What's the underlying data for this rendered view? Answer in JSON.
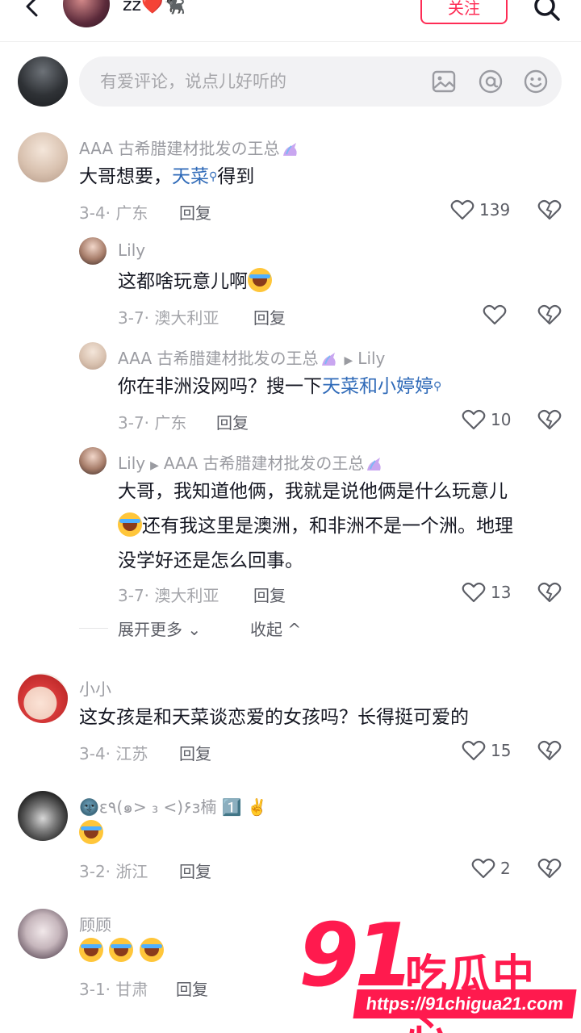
{
  "header": {
    "title": "zz❤️🐈‍⬛",
    "follow_label": "关注"
  },
  "composer": {
    "placeholder": "有爱评论，说点儿好听的"
  },
  "comments": [
    {
      "user": "AAA 古希腊建材批发の王总",
      "text_before": "大哥想要，",
      "link": "天菜",
      "text_after": "得到",
      "meta": "3-4· 广东",
      "reply": "回复",
      "likes": "139"
    },
    {
      "user": "Lily",
      "text": "这都啥玩意儿啊",
      "meta": "3-7· 澳大利亚",
      "reply": "回复",
      "likes": ""
    },
    {
      "user": "AAA 古希腊建材批发の王总",
      "reply_to": "Lily",
      "text_before": "你在非洲没网吗？搜一下",
      "link": "天菜和小婷婷",
      "meta": "3-7· 广东",
      "reply": "回复",
      "likes": "10"
    },
    {
      "user": "Lily",
      "reply_to": "AAA 古希腊建材批发の王总",
      "line1": "大哥，我知道他俩，我就是说他俩是什么玩意儿",
      "line2": "还有我这里是澳洲，和非洲不是一个洲。地理",
      "line3": "没学好还是怎么回事。",
      "meta": "3-7· 澳大利亚",
      "reply": "回复",
      "likes": "13"
    },
    {
      "user": "小小",
      "text": "这女孩是和天菜谈恋爱的女孩吗？长得挺可爱的",
      "meta": "3-4· 江苏",
      "reply": "回复",
      "likes": "15"
    },
    {
      "user": "🌚ε٩(๑> ₃ <)۶з楠 1️⃣ ✌️",
      "meta": "3-2· 浙江",
      "reply": "回复",
      "likes": "2"
    },
    {
      "user": "顾顾",
      "meta": "3-1· 甘肃",
      "reply": "回复"
    }
  ],
  "thread_controls": {
    "expand": "展开更多 ⌄",
    "collapse": "收起 ^"
  },
  "watermark": {
    "number": "91",
    "name": "吃瓜中心",
    "url": "https://91chigua21.com"
  },
  "colors": {
    "accent": "#fe2c55",
    "link": "#2f6ab8",
    "watermark": "#ff1a4e"
  }
}
